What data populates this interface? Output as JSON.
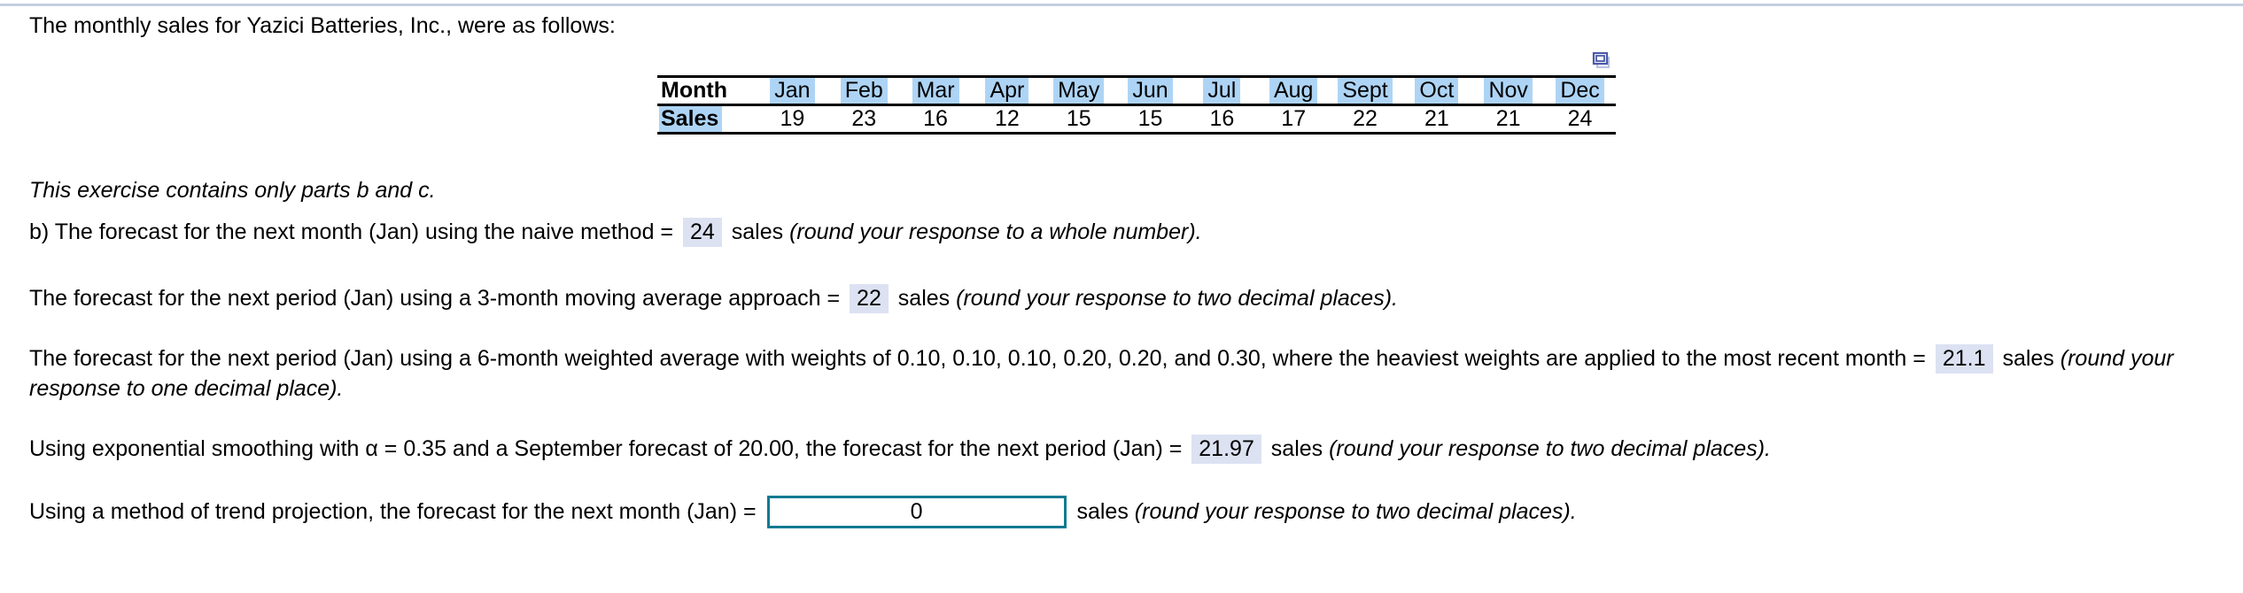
{
  "intro": {
    "text": "The monthly sales for Yazici Batteries, Inc., were as follows:"
  },
  "icons": {
    "copy": "copy-duplicate-icon"
  },
  "table": {
    "row_labels": {
      "month": "Month",
      "sales": "Sales"
    },
    "months": [
      "Jan",
      "Feb",
      "Mar",
      "Apr",
      "May",
      "Jun",
      "Jul",
      "Aug",
      "Sept",
      "Oct",
      "Nov",
      "Dec"
    ],
    "sales": [
      "19",
      "23",
      "16",
      "12",
      "15",
      "15",
      "16",
      "17",
      "22",
      "21",
      "21",
      "24"
    ]
  },
  "note": {
    "text": "This exercise contains only parts b and c."
  },
  "questions": {
    "naive": {
      "prefix": "b) The forecast for the next month (Jan) using the naive method = ",
      "answer": "24",
      "mid": " sales ",
      "hint": "(round your response to a whole number)."
    },
    "moving_average": {
      "prefix": "The forecast for the next period (Jan) using a 3-month moving average approach = ",
      "answer": "22",
      "mid": " sales ",
      "hint": "(round your response to two decimal places)."
    },
    "weighted_average": {
      "prefix": "The forecast for the next period (Jan) using a 6-month weighted average with weights of 0.10, 0.10, 0.10, 0.20, 0.20, and 0.30, where the heaviest weights are applied to the most recent month = ",
      "answer": "21.1",
      "mid": " sales ",
      "hint": "(round your response to one decimal place)."
    },
    "exponential_smoothing": {
      "prefix": "Using exponential smoothing with α = 0.35 and a September forecast of 20.00, the forecast for the next period (Jan) = ",
      "answer": "21.97",
      "mid": " sales ",
      "hint": "(round your response to two decimal places)."
    },
    "trend_projection": {
      "prefix": "Using a method of trend projection, the forecast for the next month (Jan) = ",
      "answer": "0",
      "mid": " sales ",
      "hint": "(round your response to two decimal places)."
    }
  },
  "colors": {
    "table_highlight": "#aed4f5",
    "answer_highlight": "#dce2f2",
    "input_border": "#107a92",
    "top_rule": "#c6cee0"
  }
}
